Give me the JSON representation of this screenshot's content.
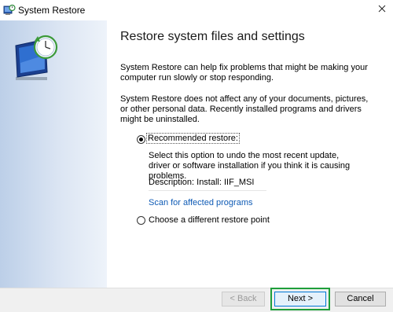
{
  "window": {
    "title": "System Restore"
  },
  "main": {
    "heading": "Restore system files and settings",
    "intro": "System Restore can help fix problems that might be making your computer run slowly or stop responding.",
    "note": "System Restore does not affect any of your documents, pictures, or other personal data. Recently installed programs and drivers might be uninstalled."
  },
  "options": {
    "recommended": {
      "label": "Recommended restore:",
      "selected": true,
      "explanation": "Select this option to undo the most recent update, driver or software installation if you think it is causing problems.",
      "description": "Description: Install: IIF_MSI",
      "scan_link": "Scan for affected programs"
    },
    "different": {
      "label": "Choose a different restore point",
      "selected": false
    }
  },
  "footer": {
    "back_label": "Back",
    "next_label": "Next",
    "cancel_label": "Cancel"
  },
  "colors": {
    "highlight": "#1e9e3a",
    "link": "#0f5bb5",
    "accent": "#0078d7"
  }
}
